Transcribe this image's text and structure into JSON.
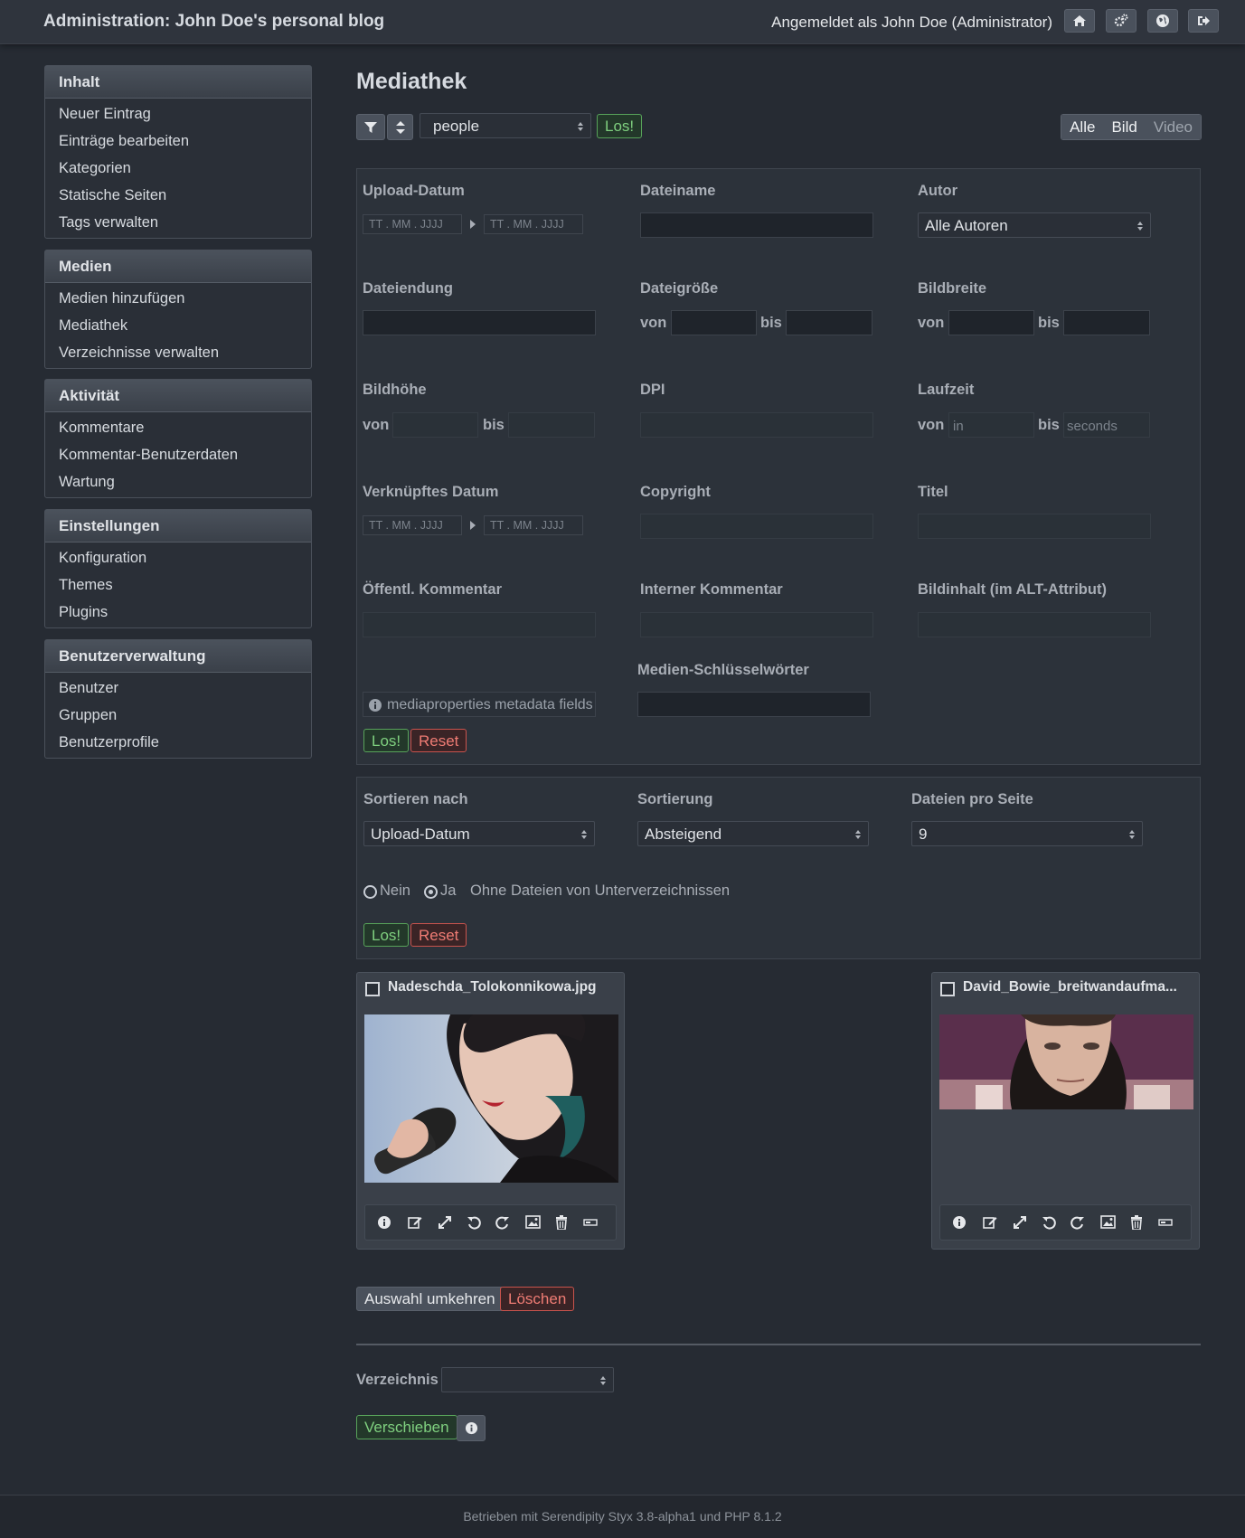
{
  "header": {
    "title": "Administration: John Doe's personal blog",
    "logged_in": "Angemeldet als John Doe (Administrator)",
    "buttons": [
      "home-icon",
      "gears-icon",
      "globe-icon",
      "logout-icon"
    ]
  },
  "sidebar": {
    "sections": [
      {
        "title": "Inhalt",
        "items": [
          "Neuer Eintrag",
          "Einträge bearbeiten",
          "Kategorien",
          "Statische Seiten",
          "Tags verwalten"
        ]
      },
      {
        "title": "Medien",
        "items": [
          "Medien hinzufügen",
          "Mediathek",
          "Verzeichnisse verwalten"
        ]
      },
      {
        "title": "Aktivität",
        "items": [
          "Kommentare",
          "Kommentar-Benutzerdaten",
          "Wartung"
        ]
      },
      {
        "title": "Einstellungen",
        "items": [
          "Konfiguration",
          "Themes",
          "Plugins"
        ]
      },
      {
        "title": "Benutzerverwaltung",
        "items": [
          "Benutzer",
          "Gruppen",
          "Benutzerprofile"
        ]
      }
    ]
  },
  "main": {
    "title": "Mediathek",
    "toolbar": {
      "directory": "people",
      "go": "Los!",
      "filter_all": "Alle",
      "filter_image": "Bild",
      "filter_video": "Video"
    },
    "filter": {
      "upload_date": "Upload-Datum",
      "filename": "Dateiname",
      "author": "Autor",
      "author_value": "Alle Autoren",
      "extension": "Dateiendung",
      "filesize": "Dateigröße",
      "imagewidth": "Bildbreite",
      "imageheight": "Bildhöhe",
      "dpi": "DPI",
      "runtime": "Laufzeit",
      "linked_date": "Verknüpftes Datum",
      "copyright": "Copyright",
      "titel": "Titel",
      "public_comment": "Öffentl. Kommentar",
      "internal_comment": "Interner Kommentar",
      "alt": "Bildinhalt (im ALT-Attribut)",
      "keywords": "Medien-Schlüsselwörter",
      "metadata_note": "mediaproperties metadata fields",
      "von": "von",
      "bis": "bis",
      "date_ph": "TT . MM . JJJJ",
      "runtime_from_ph": "in",
      "runtime_to_ph": "seconds",
      "go": "Los!",
      "reset": "Reset"
    },
    "sort": {
      "sort_by": "Sortieren nach",
      "sort_by_value": "Upload-Datum",
      "order": "Sortierung",
      "order_value": "Absteigend",
      "per_page": "Dateien pro Seite",
      "per_page_value": "9",
      "no": "Nein",
      "yes": "Ja",
      "subdir_label": "Ohne Dateien von Unterverzeichnissen",
      "go": "Los!",
      "reset": "Reset"
    },
    "files": [
      {
        "name": "Nadeschda_Tolokonnikowa.jpg"
      },
      {
        "name": "David_Bowie_breitwandaufma..."
      }
    ],
    "file_tools": [
      "info-icon",
      "edit-icon",
      "resize-icon",
      "rotate-left-icon",
      "rotate-right-icon",
      "image-icon",
      "trash-icon",
      "rename-icon"
    ],
    "actions": {
      "invert": "Auswahl umkehren",
      "delete": "Löschen"
    },
    "move": {
      "directory_label": "Verzeichnis",
      "move": "Verschieben"
    }
  },
  "footer": "Betrieben mit Serendipity Styx 3.8-alpha1 und PHP 8.1.2",
  "colors": {
    "bg": "#262b33",
    "panel": "#2c323a",
    "green": "#7fd07f",
    "red": "#ef7c74"
  }
}
